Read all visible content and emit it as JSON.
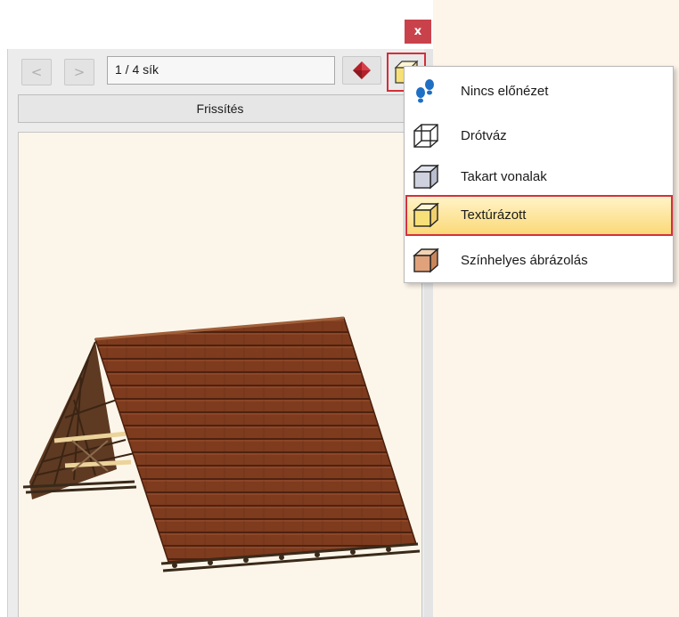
{
  "window": {
    "close_glyph": "x"
  },
  "toolbar": {
    "prev_glyph": "<",
    "next_glyph": ">",
    "plane_value": "1 / 4 sík",
    "material_icon": "red-diamond-icon",
    "view_mode_icon": "textured-box-icon"
  },
  "refresh_label": "Frissítés",
  "menu": {
    "items": [
      {
        "label": "Nincs előnézet",
        "icon": "footprints-icon"
      },
      {
        "label": "Drótváz",
        "icon": "wireframe-box-icon"
      },
      {
        "label": "Takart vonalak",
        "icon": "hidden-lines-box-icon"
      },
      {
        "label": "Textúrázott",
        "icon": "textured-box-icon",
        "selected": true
      },
      {
        "label": "Színhelyes ábrázolás",
        "icon": "color-box-icon"
      }
    ]
  },
  "colors": {
    "close_button": "#c9424b",
    "highlight_border": "#d32f3a",
    "preview_background": "#fcf6ea",
    "roof_tile": "#7e3b1e",
    "selected_item_gradient": [
      "#fff3c7",
      "#fbd978"
    ]
  }
}
